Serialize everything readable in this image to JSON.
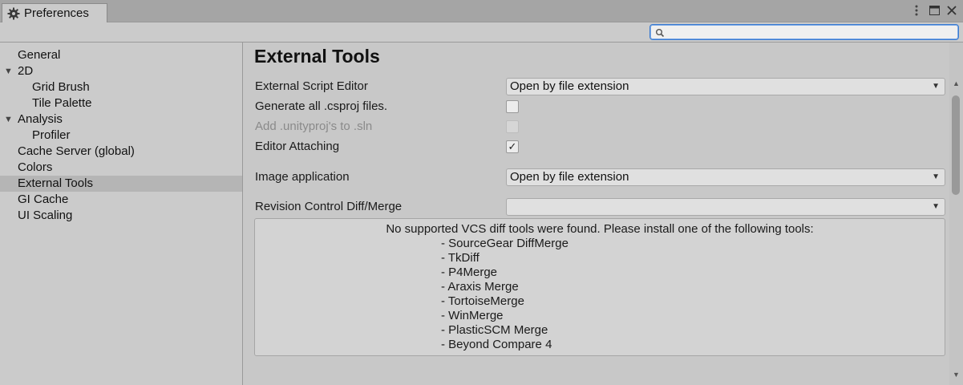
{
  "window": {
    "tab_title": "Preferences",
    "tab_icon": "gear-icon",
    "controls": [
      "more-icon",
      "maximize-icon",
      "close-icon"
    ]
  },
  "search": {
    "value": "",
    "placeholder": ""
  },
  "sidebar": {
    "items": [
      {
        "label": "General",
        "level": 0,
        "expanded": null,
        "selected": false
      },
      {
        "label": "2D",
        "level": 0,
        "expanded": true,
        "selected": false
      },
      {
        "label": "Grid Brush",
        "level": 1,
        "expanded": null,
        "selected": false
      },
      {
        "label": "Tile Palette",
        "level": 1,
        "expanded": null,
        "selected": false
      },
      {
        "label": "Analysis",
        "level": 0,
        "expanded": true,
        "selected": false
      },
      {
        "label": "Profiler",
        "level": 1,
        "expanded": null,
        "selected": false
      },
      {
        "label": "Cache Server (global)",
        "level": 0,
        "expanded": null,
        "selected": false
      },
      {
        "label": "Colors",
        "level": 0,
        "expanded": null,
        "selected": false
      },
      {
        "label": "External Tools",
        "level": 0,
        "expanded": null,
        "selected": true
      },
      {
        "label": "GI Cache",
        "level": 0,
        "expanded": null,
        "selected": false
      },
      {
        "label": "UI Scaling",
        "level": 0,
        "expanded": null,
        "selected": false
      }
    ]
  },
  "main": {
    "title": "External Tools",
    "external_script_editor": {
      "label": "External Script Editor",
      "value": "Open by file extension"
    },
    "generate_csproj": {
      "label": "Generate all .csproj files.",
      "checked": false
    },
    "add_unityproj": {
      "label": "Add .unityproj's to .sln",
      "checked": false,
      "disabled": true
    },
    "editor_attaching": {
      "label": "Editor Attaching",
      "checked": true,
      "check_glyph": "✓"
    },
    "image_application": {
      "label": "Image application",
      "value": "Open by file extension"
    },
    "revision_control": {
      "label": "Revision Control Diff/Merge",
      "value": ""
    },
    "vcs_help": {
      "message": "No supported VCS diff tools were found. Please install one of the following tools:",
      "tools": [
        "- SourceGear DiffMerge",
        "- TkDiff",
        "- P4Merge",
        "- Araxis Merge",
        "- TortoiseMerge",
        "- WinMerge",
        "- PlasticSCM Merge",
        "- Beyond Compare 4"
      ]
    }
  },
  "colors": {
    "accent": "#3b7bd0",
    "selected_row": "#b5b5b5",
    "panel": "#cbcbcb"
  }
}
